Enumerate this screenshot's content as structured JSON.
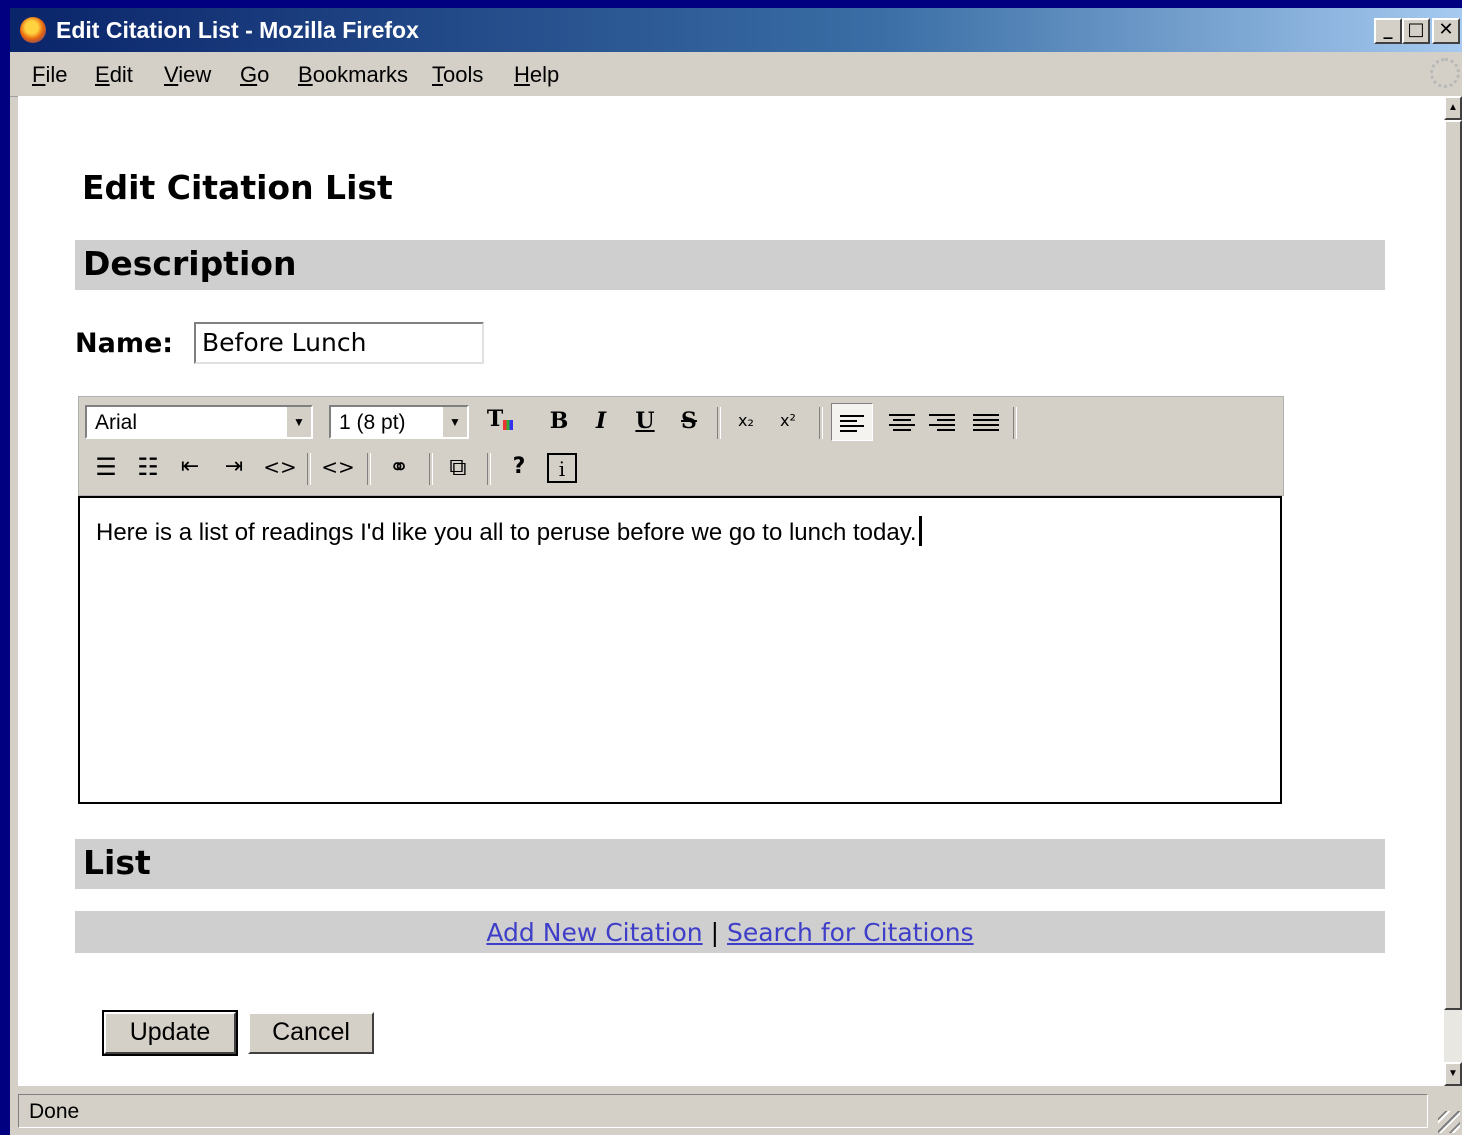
{
  "window": {
    "title": "Edit Citation List - Mozilla Firefox"
  },
  "titlebar_buttons": {
    "minimize": "_",
    "maximize": "□",
    "close": "✕"
  },
  "menu": [
    "File",
    "Edit",
    "View",
    "Go",
    "Bookmarks",
    "Tools",
    "Help"
  ],
  "menu_mnemonic_index": [
    0,
    0,
    0,
    0,
    0,
    0,
    0
  ],
  "page": {
    "title": "Edit Citation List",
    "description_heading": "Description",
    "name_label": "Name:",
    "name_value": "Before Lunch",
    "list_heading": "List",
    "add_link": "Add New Citation",
    "link_separator": "|",
    "search_link": "Search for Citations",
    "update_button": "Update",
    "cancel_button": "Cancel"
  },
  "editor": {
    "font": "Arial",
    "size": "1 (8 pt)",
    "content": "Here is a list of readings I'd like you all to peruse before we go to lunch today.",
    "toolbar_icons": [
      "text-color-icon",
      "bold-icon",
      "italic-icon",
      "underline-icon",
      "strikethrough-icon",
      "subscript-icon",
      "superscript-icon",
      "align-left-icon",
      "align-center-icon",
      "align-right-icon",
      "justify-icon",
      "ordered-list-icon",
      "unordered-list-icon",
      "outdent-icon",
      "indent-icon",
      "html-source-icon",
      "html-source-icon",
      "link-icon",
      "popup-icon",
      "help-icon",
      "info-icon"
    ],
    "glyphs": {
      "bold": "B",
      "italic": "I",
      "underline": "U",
      "strike": "S",
      "sub": "x₂",
      "sup": "x²",
      "code": "<>",
      "link": "⚭",
      "help": "?",
      "info": "i",
      "textcolor": "T"
    }
  },
  "status": {
    "text": "Done"
  },
  "colors": {
    "titlebar": "#0a246a",
    "link": "#3e3ec8",
    "section_bar": "#cfcfcf",
    "desktop": "#000080"
  }
}
